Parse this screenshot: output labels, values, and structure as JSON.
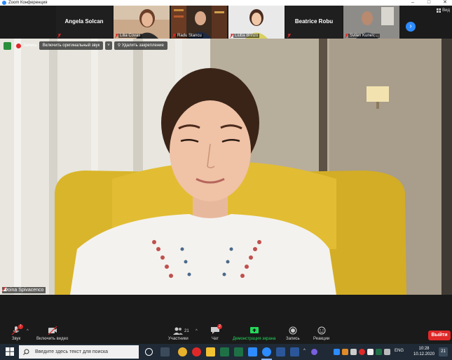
{
  "window": {
    "title": "Zoom Конференция",
    "minimize": "–",
    "maximize": "□",
    "close": "✕"
  },
  "gallery": {
    "tiles": [
      {
        "name": "Angela Solcan",
        "type": "name"
      },
      {
        "name": "Lilia Covas",
        "type": "video"
      },
      {
        "name": "Radu Stancu",
        "type": "video"
      },
      {
        "name": "Liuba Brinzo",
        "type": "video"
      },
      {
        "name": "Beatrice Robu",
        "type": "name"
      },
      {
        "name": "Svilen Kunev,...",
        "type": "video"
      }
    ],
    "next_icon": "›",
    "view_label": "Вид"
  },
  "main": {
    "recording_label": "Запись",
    "original_sound_button": "Включить оригинальный звук",
    "original_sound_caret": "˅",
    "unpin_label": "Удалить закрепление",
    "speaker_name": "Doina Spivacenco"
  },
  "toolbar": {
    "audio_label": "Звук",
    "video_label": "Включить видео",
    "participants_label": "Участники",
    "participants_count": "21",
    "chat_label": "Чат",
    "chat_badge": "2",
    "share_label": "Демонстрация экрана",
    "record_label": "Запись",
    "reactions_label": "Реакции",
    "leave_label": "Выйти",
    "audio_caret": "^",
    "participants_caret": "^",
    "audio_badge": "!"
  },
  "taskbar": {
    "search_placeholder": "Введите здесь текст для поиска",
    "language": "ENG",
    "time": "10:28",
    "date": "10.12.2020",
    "notifications": "21",
    "tray_chevron": "^"
  },
  "colors": {
    "accent": "#2d8cff",
    "share": "#23d959",
    "leave": "#e02828",
    "shield": "#2a8f3b"
  }
}
